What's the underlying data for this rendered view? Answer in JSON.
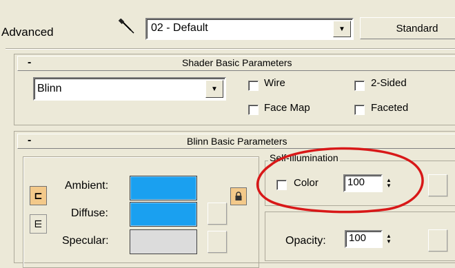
{
  "header": {
    "mode_label": "Advanced",
    "material_name": "02 - Default",
    "material_type_button": "Standard"
  },
  "shader_rollout": {
    "collapse_symbol": "-",
    "title": "Shader Basic Parameters",
    "shader_value": "Blinn",
    "wire_label": "Wire",
    "two_sided_label": "2-Sided",
    "face_map_label": "Face Map",
    "faceted_label": "Faceted"
  },
  "blinn_rollout": {
    "collapse_symbol": "-",
    "title": "Blinn Basic Parameters",
    "ambient_label": "Ambient:",
    "diffuse_label": "Diffuse:",
    "specular_label": "Specular:",
    "self_illumination_title": "Self-Illumination",
    "color_label": "Color",
    "self_illumination_value": "100",
    "opacity_label": "Opacity:",
    "opacity_value": "100"
  },
  "colors": {
    "ambient": "#1aa0f0",
    "diffuse": "#1aa0f0",
    "specular": "#dcdcdc",
    "highlight_ellipse": "#d81818",
    "lock_button": "#f3c98a"
  },
  "icons": {
    "eyedropper": "eyedropper-icon",
    "dropdown_arrow": "down-arrow-icon",
    "lock": "lock-icon",
    "link_ambient_diffuse": "link-bracket-icon"
  }
}
